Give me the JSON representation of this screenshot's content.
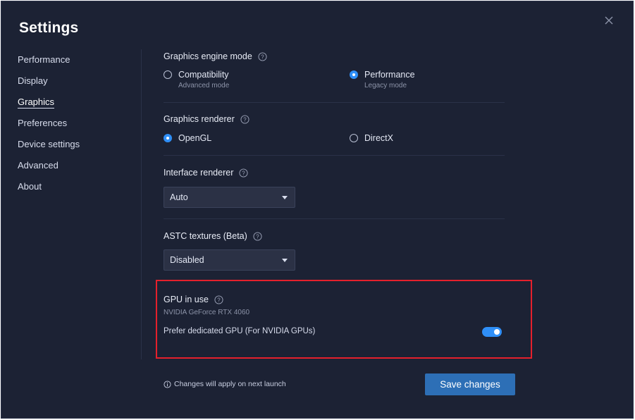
{
  "window": {
    "title": "Settings"
  },
  "sidebar": {
    "items": [
      {
        "label": "Performance",
        "active": false
      },
      {
        "label": "Display",
        "active": false
      },
      {
        "label": "Graphics",
        "active": true
      },
      {
        "label": "Preferences",
        "active": false
      },
      {
        "label": "Device settings",
        "active": false
      },
      {
        "label": "Advanced",
        "active": false
      },
      {
        "label": "About",
        "active": false
      }
    ]
  },
  "graphics_engine_mode": {
    "label": "Graphics engine mode",
    "options": [
      {
        "label": "Compatibility",
        "sublabel": "Advanced mode",
        "selected": false
      },
      {
        "label": "Performance",
        "sublabel": "Legacy mode",
        "selected": true
      }
    ]
  },
  "graphics_renderer": {
    "label": "Graphics renderer",
    "options": [
      {
        "label": "OpenGL",
        "selected": true
      },
      {
        "label": "DirectX",
        "selected": false
      }
    ]
  },
  "interface_renderer": {
    "label": "Interface renderer",
    "value": "Auto"
  },
  "astc_textures": {
    "label": "ASTC textures (Beta)",
    "value": "Disabled"
  },
  "gpu": {
    "label": "GPU in use",
    "name": "NVIDIA GeForce RTX 4060",
    "prefer_label": "Prefer dedicated GPU (For NVIDIA GPUs)",
    "prefer_enabled": true
  },
  "footer": {
    "note": "Changes will apply on next launch",
    "save_label": "Save changes"
  },
  "colors": {
    "background": "#1c2234",
    "accent": "#2f8ff7",
    "button": "#2d6fb6",
    "highlight_border": "#e5202c"
  },
  "icons": {
    "close": "close-icon",
    "help": "help-icon",
    "info": "info-icon",
    "dropdown": "chevron-down-icon"
  }
}
